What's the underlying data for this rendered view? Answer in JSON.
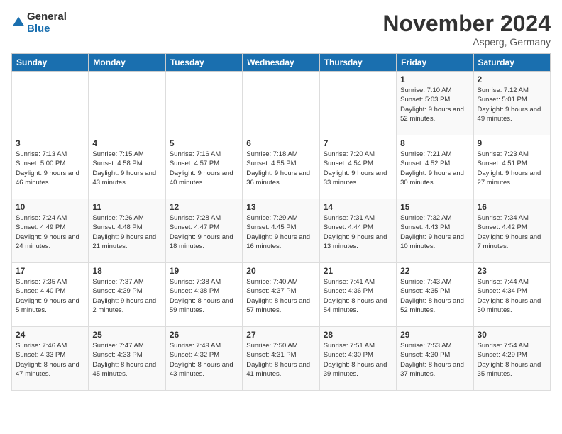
{
  "header": {
    "logo_general": "General",
    "logo_blue": "Blue",
    "month_title": "November 2024",
    "location": "Asperg, Germany"
  },
  "weekdays": [
    "Sunday",
    "Monday",
    "Tuesday",
    "Wednesday",
    "Thursday",
    "Friday",
    "Saturday"
  ],
  "weeks": [
    [
      {
        "day": "",
        "info": ""
      },
      {
        "day": "",
        "info": ""
      },
      {
        "day": "",
        "info": ""
      },
      {
        "day": "",
        "info": ""
      },
      {
        "day": "",
        "info": ""
      },
      {
        "day": "1",
        "info": "Sunrise: 7:10 AM\nSunset: 5:03 PM\nDaylight: 9 hours\nand 52 minutes."
      },
      {
        "day": "2",
        "info": "Sunrise: 7:12 AM\nSunset: 5:01 PM\nDaylight: 9 hours\nand 49 minutes."
      }
    ],
    [
      {
        "day": "3",
        "info": "Sunrise: 7:13 AM\nSunset: 5:00 PM\nDaylight: 9 hours\nand 46 minutes."
      },
      {
        "day": "4",
        "info": "Sunrise: 7:15 AM\nSunset: 4:58 PM\nDaylight: 9 hours\nand 43 minutes."
      },
      {
        "day": "5",
        "info": "Sunrise: 7:16 AM\nSunset: 4:57 PM\nDaylight: 9 hours\nand 40 minutes."
      },
      {
        "day": "6",
        "info": "Sunrise: 7:18 AM\nSunset: 4:55 PM\nDaylight: 9 hours\nand 36 minutes."
      },
      {
        "day": "7",
        "info": "Sunrise: 7:20 AM\nSunset: 4:54 PM\nDaylight: 9 hours\nand 33 minutes."
      },
      {
        "day": "8",
        "info": "Sunrise: 7:21 AM\nSunset: 4:52 PM\nDaylight: 9 hours\nand 30 minutes."
      },
      {
        "day": "9",
        "info": "Sunrise: 7:23 AM\nSunset: 4:51 PM\nDaylight: 9 hours\nand 27 minutes."
      }
    ],
    [
      {
        "day": "10",
        "info": "Sunrise: 7:24 AM\nSunset: 4:49 PM\nDaylight: 9 hours\nand 24 minutes."
      },
      {
        "day": "11",
        "info": "Sunrise: 7:26 AM\nSunset: 4:48 PM\nDaylight: 9 hours\nand 21 minutes."
      },
      {
        "day": "12",
        "info": "Sunrise: 7:28 AM\nSunset: 4:47 PM\nDaylight: 9 hours\nand 18 minutes."
      },
      {
        "day": "13",
        "info": "Sunrise: 7:29 AM\nSunset: 4:45 PM\nDaylight: 9 hours\nand 16 minutes."
      },
      {
        "day": "14",
        "info": "Sunrise: 7:31 AM\nSunset: 4:44 PM\nDaylight: 9 hours\nand 13 minutes."
      },
      {
        "day": "15",
        "info": "Sunrise: 7:32 AM\nSunset: 4:43 PM\nDaylight: 9 hours\nand 10 minutes."
      },
      {
        "day": "16",
        "info": "Sunrise: 7:34 AM\nSunset: 4:42 PM\nDaylight: 9 hours\nand 7 minutes."
      }
    ],
    [
      {
        "day": "17",
        "info": "Sunrise: 7:35 AM\nSunset: 4:40 PM\nDaylight: 9 hours\nand 5 minutes."
      },
      {
        "day": "18",
        "info": "Sunrise: 7:37 AM\nSunset: 4:39 PM\nDaylight: 9 hours\nand 2 minutes."
      },
      {
        "day": "19",
        "info": "Sunrise: 7:38 AM\nSunset: 4:38 PM\nDaylight: 8 hours\nand 59 minutes."
      },
      {
        "day": "20",
        "info": "Sunrise: 7:40 AM\nSunset: 4:37 PM\nDaylight: 8 hours\nand 57 minutes."
      },
      {
        "day": "21",
        "info": "Sunrise: 7:41 AM\nSunset: 4:36 PM\nDaylight: 8 hours\nand 54 minutes."
      },
      {
        "day": "22",
        "info": "Sunrise: 7:43 AM\nSunset: 4:35 PM\nDaylight: 8 hours\nand 52 minutes."
      },
      {
        "day": "23",
        "info": "Sunrise: 7:44 AM\nSunset: 4:34 PM\nDaylight: 8 hours\nand 50 minutes."
      }
    ],
    [
      {
        "day": "24",
        "info": "Sunrise: 7:46 AM\nSunset: 4:33 PM\nDaylight: 8 hours\nand 47 minutes."
      },
      {
        "day": "25",
        "info": "Sunrise: 7:47 AM\nSunset: 4:33 PM\nDaylight: 8 hours\nand 45 minutes."
      },
      {
        "day": "26",
        "info": "Sunrise: 7:49 AM\nSunset: 4:32 PM\nDaylight: 8 hours\nand 43 minutes."
      },
      {
        "day": "27",
        "info": "Sunrise: 7:50 AM\nSunset: 4:31 PM\nDaylight: 8 hours\nand 41 minutes."
      },
      {
        "day": "28",
        "info": "Sunrise: 7:51 AM\nSunset: 4:30 PM\nDaylight: 8 hours\nand 39 minutes."
      },
      {
        "day": "29",
        "info": "Sunrise: 7:53 AM\nSunset: 4:30 PM\nDaylight: 8 hours\nand 37 minutes."
      },
      {
        "day": "30",
        "info": "Sunrise: 7:54 AM\nSunset: 4:29 PM\nDaylight: 8 hours\nand 35 minutes."
      }
    ]
  ]
}
